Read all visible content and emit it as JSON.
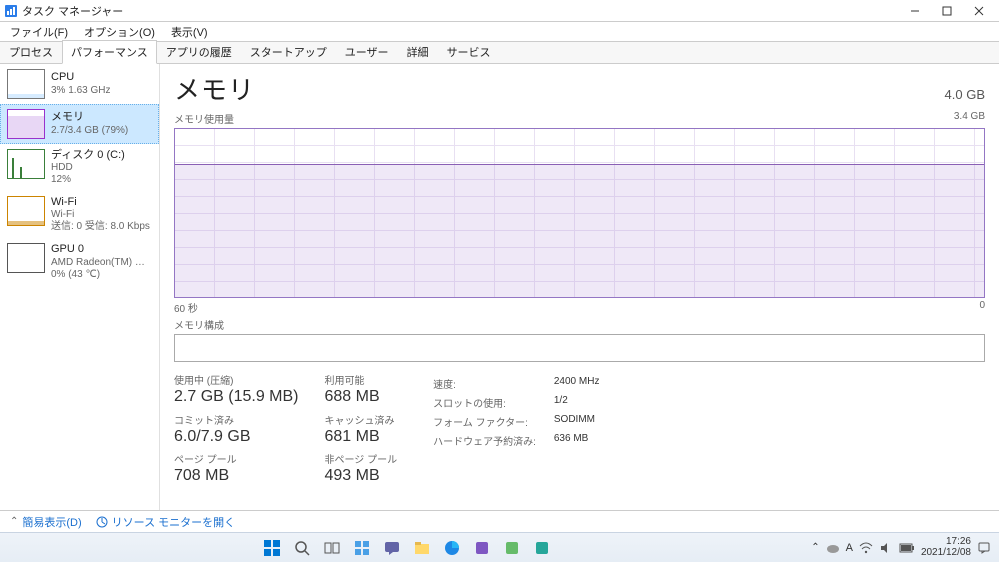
{
  "window": {
    "title": "タスク マネージャー"
  },
  "menu": {
    "file": "ファイル(F)",
    "options": "オプション(O)",
    "view": "表示(V)"
  },
  "tabs": {
    "processes": "プロセス",
    "performance": "パフォーマンス",
    "apphistory": "アプリの履歴",
    "startup": "スタートアップ",
    "users": "ユーザー",
    "details": "詳細",
    "services": "サービス"
  },
  "sidebar": {
    "cpu": {
      "title": "CPU",
      "sub": "3%  1.63 GHz"
    },
    "mem": {
      "title": "メモリ",
      "sub": "2.7/3.4 GB (79%)"
    },
    "disk": {
      "title": "ディスク 0 (C:)",
      "sub": "HDD",
      "sub2": "12%"
    },
    "wifi": {
      "title": "Wi-Fi",
      "sub": "Wi-Fi",
      "sub2": "送信: 0 受信: 8.0 Kbps"
    },
    "gpu": {
      "title": "GPU 0",
      "sub": "AMD Radeon(TM) …",
      "sub2": "0% (43 ℃)"
    }
  },
  "detail": {
    "title": "メモリ",
    "capacity": "4.0 GB",
    "chart_top_left": "メモリ使用量",
    "chart_top_right": "3.4 GB",
    "axis_left": "60 秒",
    "axis_right": "0",
    "composition_label": "メモリ構成",
    "stats": {
      "inuse_label": "使用中 (圧縮)",
      "inuse_value": "2.7 GB (15.9 MB)",
      "avail_label": "利用可能",
      "avail_value": "688 MB",
      "commit_label": "コミット済み",
      "commit_value": "6.0/7.9 GB",
      "cache_label": "キャッシュ済み",
      "cache_value": "681 MB",
      "pagedpool_label": "ページ プール",
      "pagedpool_value": "708 MB",
      "nonpaged_label": "非ページ プール",
      "nonpaged_value": "493 MB"
    },
    "right": {
      "speed_l": "速度:",
      "speed_v": "2400 MHz",
      "slots_l": "スロットの使用:",
      "slots_v": "1/2",
      "form_l": "フォーム ファクター:",
      "form_v": "SODIMM",
      "hw_l": "ハードウェア予約済み:",
      "hw_v": "636 MB"
    }
  },
  "footer": {
    "fewer": "簡易表示(D)",
    "resmon": "リソース モニターを開く"
  },
  "tray": {
    "ime": "A",
    "time": "17:26",
    "date": "2021/12/08"
  },
  "chart_data": {
    "type": "area",
    "title": "メモリ使用量",
    "xlabel": "60 秒",
    "ylabel": "GB",
    "ylim": [
      0,
      3.4
    ],
    "x_seconds": [
      60,
      55,
      50,
      45,
      40,
      35,
      30,
      25,
      20,
      15,
      10,
      5,
      0
    ],
    "values_gb": [
      2.7,
      2.7,
      2.7,
      2.7,
      2.7,
      2.7,
      2.7,
      2.7,
      2.7,
      2.66,
      2.68,
      2.7,
      2.7
    ]
  }
}
